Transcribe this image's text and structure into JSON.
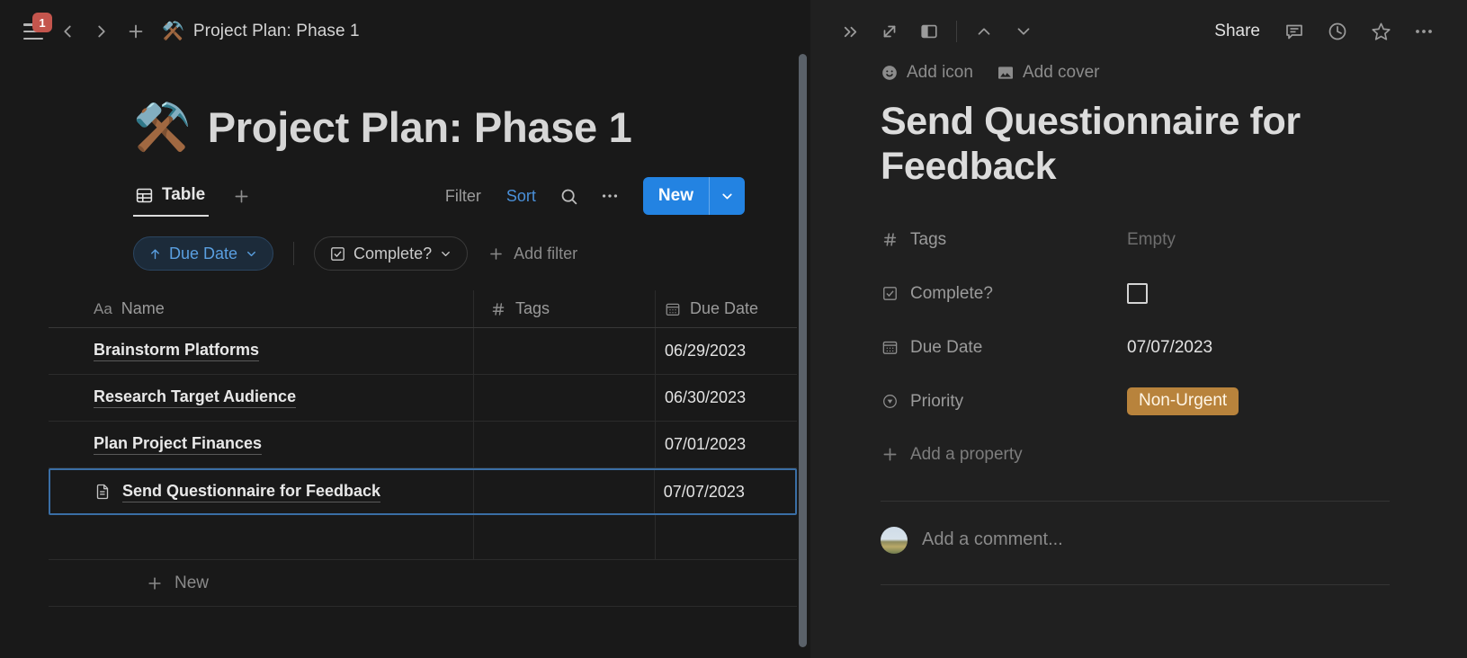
{
  "window": {
    "background": "#191919",
    "accent_blue": "#2383e2",
    "badge_red": "#c4554d",
    "tag_amber": "#b8833c",
    "selected_border": "#3a6ea5"
  },
  "topbar": {
    "notification_count": "1",
    "breadcrumb_emoji": "⚒️",
    "breadcrumb_title": "Project Plan: Phase 1"
  },
  "page": {
    "emoji": "⚒️",
    "title": "Project Plan: Phase 1"
  },
  "view_bar": {
    "tab_label": "Table",
    "filter_label": "Filter",
    "sort_label": "Sort",
    "new_label": "New"
  },
  "filter_row": {
    "sort_chip": "Due Date",
    "filter_chip": "Complete?",
    "add_filter": "Add filter"
  },
  "table": {
    "columns": [
      {
        "label": "Name",
        "icon": "aa-icon"
      },
      {
        "label": "Tags",
        "icon": "hash-icon"
      },
      {
        "label": "Due Date",
        "icon": "calendar-icon"
      }
    ],
    "rows": [
      {
        "name": "Brainstorm Platforms",
        "tags": "",
        "due_date": "06/29/2023",
        "selected": false,
        "has_doc_icon": false
      },
      {
        "name": "Research Target Audience",
        "tags": "",
        "due_date": "06/30/2023",
        "selected": false,
        "has_doc_icon": false
      },
      {
        "name": "Plan Project Finances",
        "tags": "",
        "due_date": "07/01/2023",
        "selected": false,
        "has_doc_icon": false
      },
      {
        "name": "Send Questionnaire for Feedback",
        "tags": "",
        "due_date": "07/07/2023",
        "selected": true,
        "has_doc_icon": true
      }
    ],
    "new_row_label": "New"
  },
  "peek": {
    "add_icon_label": "Add icon",
    "add_cover_label": "Add cover",
    "title": "Send Questionnaire for Feedback",
    "share_label": "Share",
    "properties": [
      {
        "label": "Tags",
        "icon": "hash-icon",
        "value": "Empty",
        "kind": "empty"
      },
      {
        "label": "Complete?",
        "icon": "checkbox-icon",
        "value": "",
        "kind": "checkbox"
      },
      {
        "label": "Due Date",
        "icon": "calendar-icon",
        "value": "07/07/2023",
        "kind": "text"
      },
      {
        "label": "Priority",
        "icon": "select-icon",
        "value": "Non-Urgent",
        "kind": "pill"
      }
    ],
    "add_property_label": "Add a property",
    "comment_placeholder": "Add a comment..."
  }
}
